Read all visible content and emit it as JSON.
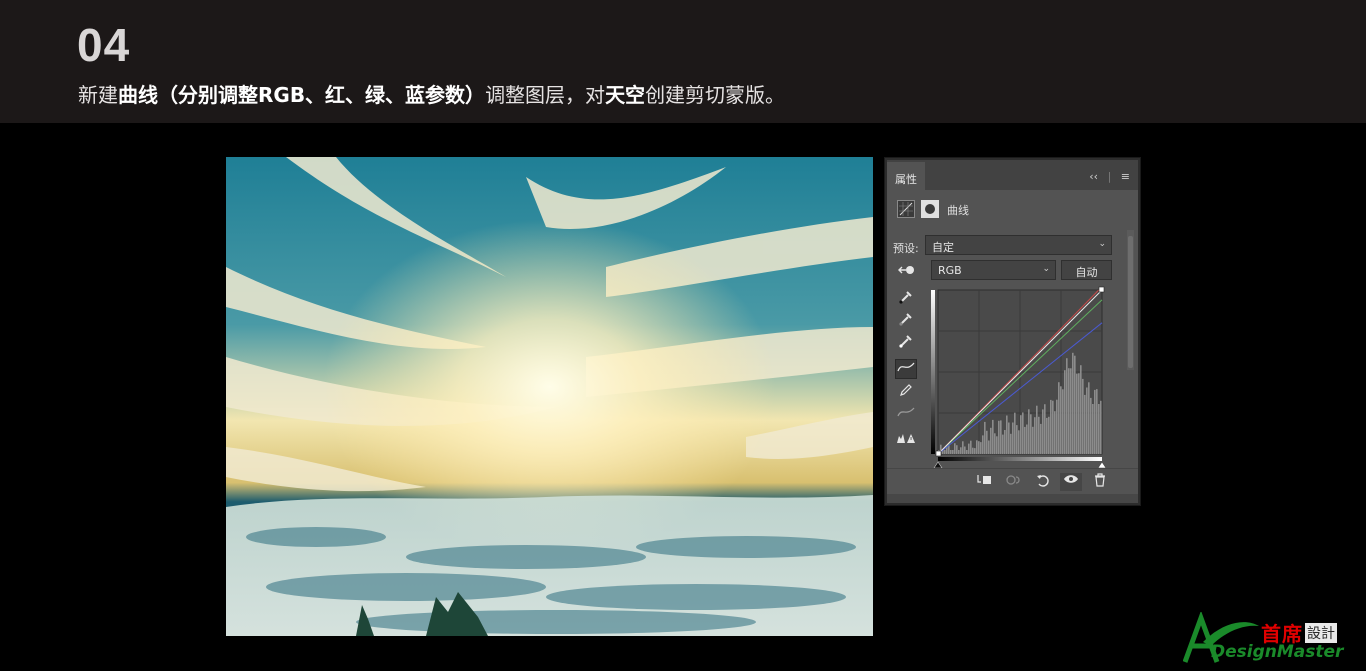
{
  "header": {
    "step_number": "04",
    "instruction": {
      "p1": "新建",
      "b1": "曲线（分别调整RGB、红、绿、蓝参数）",
      "p2": "调整图层，对",
      "b2": "天空",
      "p3": "创建剪切蒙版。"
    }
  },
  "properties_panel": {
    "tab_title": "属性",
    "collapse_icon": "double-chevron-left-icon",
    "menu_icon": "hamburger-menu-icon",
    "adjustment_name": "曲线",
    "preset_label": "预设:",
    "preset_value": "自定",
    "channel_value": "RGB",
    "auto_label": "自动",
    "tools": [
      "hand-target-icon",
      "black-eyedropper-icon",
      "gray-eyedropper-icon",
      "white-eyedropper-icon",
      "curve-point-icon",
      "pencil-icon",
      "smooth-curve-icon",
      "clipping-warning-icon"
    ],
    "bottom_actions": [
      "clip-to-layer-icon",
      "view-previous-state-icon",
      "reset-adjustment-icon",
      "toggle-visibility-icon",
      "delete-adjustment-icon"
    ],
    "curve_colors": {
      "rgb": "#e6e6e6",
      "red": "#c84a4a",
      "green": "#5fae5f",
      "blue": "#4a5ad0"
    }
  },
  "logo": {
    "chinese": "首席",
    "chinese_trad": "設計",
    "english": "DesignMaster"
  }
}
